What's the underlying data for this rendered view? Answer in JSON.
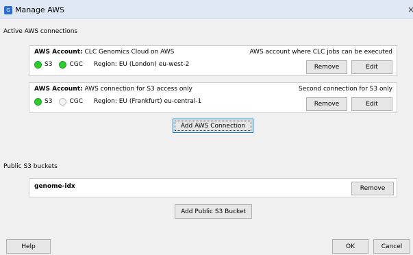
{
  "window": {
    "title": "Manage AWS",
    "app_icon": "clc-app-icon",
    "close_glyph": "×"
  },
  "active_connections": {
    "label": "Active AWS connections",
    "accounts": [
      {
        "account_label": "AWS Account:",
        "name": "CLC Genomics Cloud on AWS",
        "description": "AWS account where CLC jobs can be executed",
        "s3_label": "S3",
        "s3_status": "connected",
        "cgc_label": "CGC",
        "cgc_status": "connected",
        "region": "Region: EU (London) eu-west-2",
        "remove_label": "Remove",
        "edit_label": "Edit"
      },
      {
        "account_label": "AWS Account:",
        "name": "AWS connection for S3 access only",
        "description": "Second connection for S3 only",
        "s3_label": "S3",
        "s3_status": "connected",
        "cgc_label": "CGC",
        "cgc_status": "inactive",
        "region": "Region: EU (Frankfurt) eu-central-1",
        "remove_label": "Remove",
        "edit_label": "Edit"
      }
    ],
    "add_button": "Add AWS Connection"
  },
  "public_buckets": {
    "label": "Public S3 buckets",
    "buckets": [
      {
        "name": "genome-idx",
        "remove_label": "Remove"
      }
    ],
    "add_button": "Add Public S3 Bucket"
  },
  "footer": {
    "help": "Help",
    "ok": "OK",
    "cancel": "Cancel"
  },
  "colors": {
    "status_connected": "#2ecc2e",
    "status_inactive": "#f3f3f3",
    "titlebar": "#dfe9f6"
  }
}
